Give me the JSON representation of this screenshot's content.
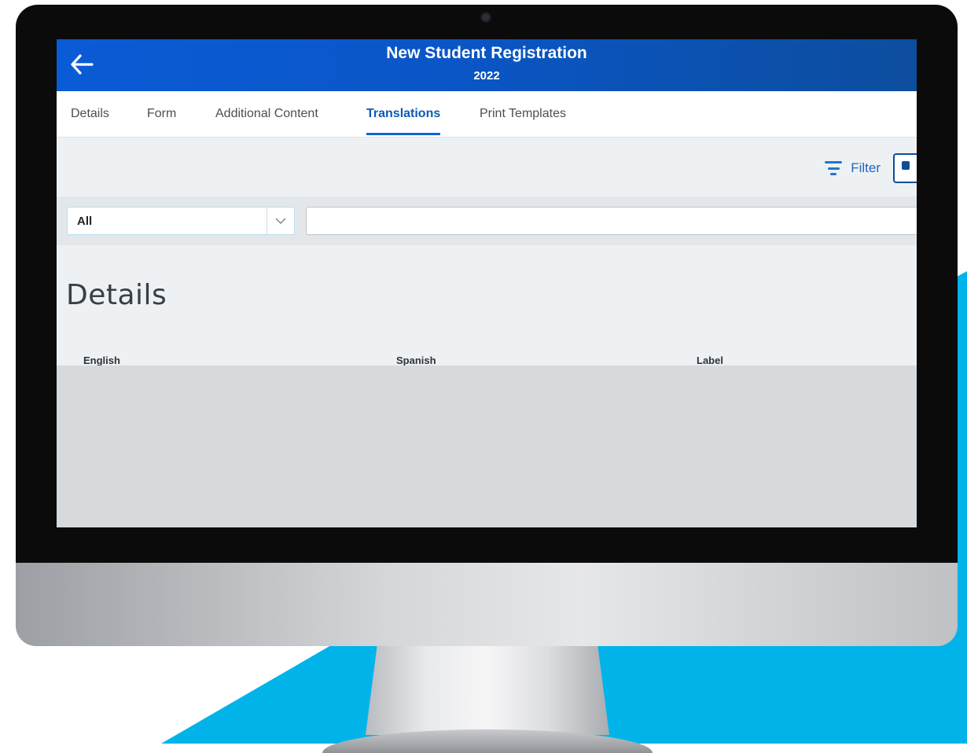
{
  "header": {
    "title": "New Student Registration",
    "subtitle": "2022"
  },
  "tabs": [
    {
      "label": "Details",
      "active": false
    },
    {
      "label": "Form",
      "active": false
    },
    {
      "label": "Additional Content",
      "active": false
    },
    {
      "label": "Translations",
      "active": true
    },
    {
      "label": "Print Templates",
      "active": false
    }
  ],
  "toolbar": {
    "filter_label": "Filter"
  },
  "search": {
    "select_value": "All",
    "input_value": "",
    "input_placeholder": ""
  },
  "section": {
    "title": "Details",
    "columns": [
      "English",
      "Spanish",
      "Label"
    ]
  },
  "colors": {
    "header_start": "#0a5bd6",
    "header_end": "#0c4d9e",
    "accent": "#0b66d6",
    "backdrop": "#00b4ea"
  },
  "icons": {
    "back": "arrow-left-icon",
    "filter": "filter-icon",
    "caret": "chevron-down-icon"
  }
}
